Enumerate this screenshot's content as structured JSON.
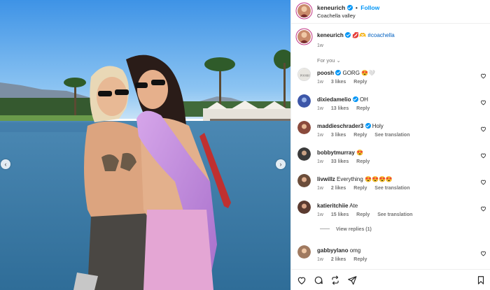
{
  "post": {
    "username": "keneurich",
    "follow_label": "Follow",
    "separator": "•",
    "location": "Coachella valley",
    "caption_user": "keneurich",
    "caption_emoji": "💋🫶",
    "caption_hashtag": "#coachella",
    "caption_time": "1w",
    "for_you_label": "For you",
    "view_replies_label": "View replies (1)"
  },
  "comments": [
    {
      "user": "poosh",
      "verified": true,
      "text": "GORG 😍🤍",
      "time": "1w",
      "likes": "3 likes",
      "reply": "Reply",
      "translate": "",
      "avatar_color": "#e8e6e1"
    },
    {
      "user": "dixiedamelio",
      "verified": true,
      "text": "OH",
      "time": "1w",
      "likes": "13 likes",
      "reply": "Reply",
      "translate": "",
      "avatar_color": "#3c56a8"
    },
    {
      "user": "maddieschrader3",
      "verified": true,
      "text": "Holy",
      "time": "1w",
      "likes": "3 likes",
      "reply": "Reply",
      "translate": "See translation",
      "avatar_color": "#8a4a3c"
    },
    {
      "user": "bobbytmurray",
      "verified": false,
      "text": "😍",
      "time": "1w",
      "likes": "33 likes",
      "reply": "Reply",
      "translate": "",
      "avatar_color": "#3a3a3a"
    },
    {
      "user": "livwillz",
      "verified": false,
      "text": "Everything 😍😍😍😍",
      "time": "1w",
      "likes": "2 likes",
      "reply": "Reply",
      "translate": "See translation",
      "avatar_color": "#6b4d3a"
    },
    {
      "user": "katieritchiie",
      "verified": false,
      "text": "Ate",
      "time": "1w",
      "likes": "15 likes",
      "reply": "Reply",
      "translate": "See translation",
      "avatar_color": "#5b3b30"
    },
    {
      "user": "gabbyylano",
      "verified": false,
      "text": "omg",
      "time": "1w",
      "likes": "2 likes",
      "reply": "Reply",
      "translate": "",
      "avatar_color": "#a07a60"
    }
  ],
  "colors": {
    "accent": "#0095f6",
    "text": "#262626",
    "muted": "#737373"
  }
}
